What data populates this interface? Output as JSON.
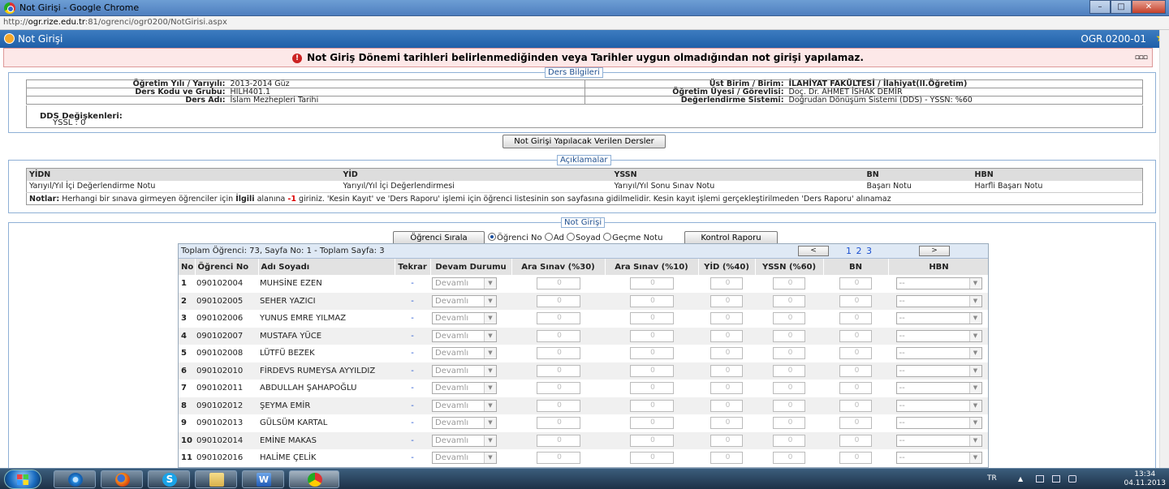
{
  "window": {
    "title": "Not Girişi - Google Chrome",
    "url_prefix": "http://",
    "url_host": "ogr.rize.edu.tr",
    "url_path": ":81/ogrenci/ogr0200/NotGirisi.aspx",
    "minimize": "–",
    "maximize": "□",
    "close": "✕"
  },
  "module": {
    "title": "Not Girişi",
    "code": "OGR.0200-01"
  },
  "warning": {
    "icon": "!",
    "text": "Not Giriş Dönemi tarihleri belirlenmediğinden veya Tarihler uygun olmadığından not girişi yapılamaz.",
    "menu": "▫▫▫"
  },
  "ders": {
    "legend": "Ders Bilgileri",
    "ogretim_yili_label": "Öğretim Yılı / Yarıyılı:",
    "ogretim_yili": "2013-2014  Güz",
    "birim_label": "Üst Birim / Birim:",
    "birim": "İLAHİYAT FAKÜLTESİ / İlahiyat(II.Öğretim)",
    "kod_label": "Ders Kodu ve Grubu:",
    "kod": "HILH401.1",
    "uye_label": "Öğretim Üyesi / Görevlisi:",
    "uye": "Doç. Dr. AHMET İSHAK DEMİR",
    "ad_label": "Ders Adı:",
    "ad": "İslam Mezhepleri Tarihi",
    "sistem_label": "Değerlendirme Sistemi:",
    "sistem": "Doğrudan Dönüşüm Sistemi (DDS) - YSSN: %60",
    "dds_label": "DDS Değişkenleri:",
    "dds": "YSSL : 0"
  },
  "verilen_btn": "Not Girişi Yapılacak Verilen Dersler",
  "aciklama": {
    "legend": "Açıklamalar",
    "headers": [
      "YİDN",
      "YİD",
      "YSSN",
      "BN",
      "HBN"
    ],
    "values": [
      "Yarıyıl/Yıl İçi Değerlendirme Notu",
      "Yarıyıl/Yıl İçi Değerlendirmesi",
      "Yarıyıl/Yıl Sonu Sınav Notu",
      "Başarı Notu",
      "Harfli Başarı Notu"
    ],
    "not_label": "Notlar:",
    "not_1": " Herhangi bir sınava girmeyen öğrenciler için ",
    "not_bold": "İlgili",
    "not_2": " alanına ",
    "not_red": "-1",
    "not_3": " giriniz. 'Kesin Kayıt' ve 'Ders Raporu' işlemi için öğrenci listesinin son sayfasına gidilmelidir. Kesin kayıt işlemi gerçekleştirilmeden 'Ders Raporu' alınamaz"
  },
  "notgiris": {
    "legend": "Not Girişi",
    "sirala_btn": "Öğrenci Sırala",
    "radios": [
      "Öğrenci No",
      "Ad",
      "Soyad",
      "Geçme Notu"
    ],
    "kontrol_btn": "Kontrol Raporu",
    "summary": "Toplam Öğrenci: 73, Sayfa No: 1 - Toplam Sayfa: 3",
    "prev": "<",
    "next": ">",
    "pages": "1 2 3",
    "columns": [
      "No",
      "Öğrenci No",
      "Adı Soyadı",
      "Tekrar",
      "Devam Durumu",
      "Ara Sınav (%30)",
      "Ara Sınav (%10)",
      "YİD (%40)",
      "YSSN (%60)",
      "BN",
      "HBN"
    ],
    "devam_value": "Devamlı",
    "input_placeholder": "0",
    "hbn_value": "--",
    "tekrar_value": "-",
    "rows": [
      {
        "no": "1",
        "ogrno": "090102004",
        "ad": "MUHSİNE EZEN"
      },
      {
        "no": "2",
        "ogrno": "090102005",
        "ad": "SEHER YAZICI"
      },
      {
        "no": "3",
        "ogrno": "090102006",
        "ad": "YUNUS EMRE YILMAZ"
      },
      {
        "no": "4",
        "ogrno": "090102007",
        "ad": "MUSTAFA YÜCE"
      },
      {
        "no": "5",
        "ogrno": "090102008",
        "ad": "LÜTFÜ BEZEK"
      },
      {
        "no": "6",
        "ogrno": "090102010",
        "ad": "FİRDEVS RUMEYSA AYYILDIZ"
      },
      {
        "no": "7",
        "ogrno": "090102011",
        "ad": "ABDULLAH ŞAHAPOĞLU"
      },
      {
        "no": "8",
        "ogrno": "090102012",
        "ad": "ŞEYMA EMİR"
      },
      {
        "no": "9",
        "ogrno": "090102013",
        "ad": "GÜLSÜM KARTAL"
      },
      {
        "no": "10",
        "ogrno": "090102014",
        "ad": "EMİNE MAKAS"
      },
      {
        "no": "11",
        "ogrno": "090102016",
        "ad": "HALİME ÇELİK"
      }
    ]
  },
  "taskbar": {
    "apps": [
      "internet-explorer-icon",
      "firefox-icon",
      "skype-icon",
      "explorer-folder-icon",
      "word-icon",
      "chrome-icon"
    ],
    "lang": "TR",
    "time": "13:34",
    "date": "04.11.2013"
  }
}
